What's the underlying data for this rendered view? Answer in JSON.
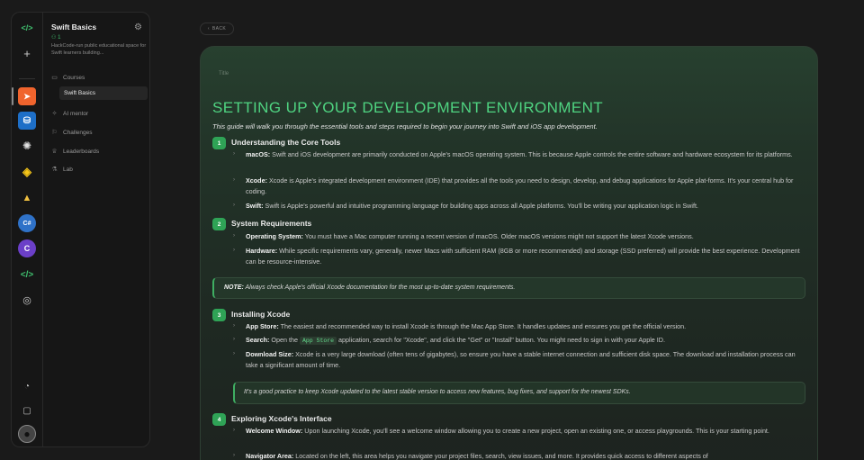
{
  "sidebar": {
    "title": "Swift Basics",
    "members": "1",
    "description": "HackCode-run public educational space for Swift learners building...",
    "nav": [
      {
        "icon": "book-icon",
        "glyph": "▭",
        "label": "Courses"
      },
      {
        "icon": "sparkle-icon",
        "glyph": "✧",
        "label": "AI mentor"
      },
      {
        "icon": "flag-icon",
        "glyph": "⚐",
        "label": "Challenges"
      },
      {
        "icon": "trophy-icon",
        "glyph": "♕",
        "label": "Leaderboards"
      },
      {
        "icon": "flask-icon",
        "glyph": "⚗",
        "label": "Lab"
      }
    ],
    "active_course": "Swift Basics"
  },
  "rail": {
    "top": [
      {
        "icon": "code-logo-icon",
        "glyph": "</>"
      },
      {
        "icon": "add-icon",
        "glyph": "+"
      }
    ],
    "spaces": [
      {
        "icon": "swift-icon",
        "glyph": "➤"
      },
      {
        "icon": "database-icon",
        "glyph": "⛁"
      },
      {
        "icon": "openai-icon",
        "glyph": "✺"
      },
      {
        "icon": "python-icon",
        "glyph": "◈"
      },
      {
        "icon": "linux-icon",
        "glyph": "▲"
      },
      {
        "icon": "csharp-icon",
        "glyph": "C#"
      },
      {
        "icon": "c-icon",
        "glyph": "C"
      },
      {
        "icon": "code-icon",
        "glyph": "</>"
      },
      {
        "icon": "compass-icon",
        "glyph": "◎"
      }
    ],
    "bottom": [
      {
        "icon": "bell-icon",
        "glyph": "◔"
      },
      {
        "icon": "chat-icon",
        "glyph": "▢"
      },
      {
        "icon": "avatar-icon",
        "glyph": "●"
      }
    ]
  },
  "back_label": "BACK",
  "content": {
    "breadcrumb": [
      "Title",
      ""
    ],
    "title": "SETTING UP YOUR DEVELOPMENT ENVIRONMENT",
    "intro": "This guide will walk you through the essential tools and steps required to begin your journey into Swift and iOS app development.",
    "sections": [
      {
        "num": "1",
        "title": "Understanding the Core Tools",
        "items": [
          {
            "term": "macOS:",
            "text": " Swift and iOS development are primarily conducted on Apple's macOS operating system. This is because Apple controls the entire software and hardware ecosystem for its platforms."
          },
          {
            "term": "Xcode:",
            "text": " Xcode is Apple's integrated development environment (IDE) that provides all the tools you need to design, develop, and debug applications for Apple plat-forms. It's your central hub for coding."
          },
          {
            "term": "Swift:",
            "text": " Swift is Apple's powerful and intuitive programming language for building apps across all Apple platforms. You'll be writing your application logic in Swift."
          }
        ]
      },
      {
        "num": "2",
        "title": "System Requirements",
        "items": [
          {
            "term": "Operating System:",
            "text": " You must have a Mac computer running a recent version of macOS. Older macOS versions might not support the latest Xcode versions."
          },
          {
            "term": "Hardware:",
            "text": " While specific requirements vary, generally, newer Macs with sufficient RAM (8GB or more recommended) and storage (SSD preferred) will provide the best experience. Development can be resource-intensive."
          }
        ]
      },
      {
        "num": "3",
        "title": "Installing Xcode",
        "items": [
          {
            "term": "App Store:",
            "text": " The easiest and recommended way to install Xcode is through the Mac App Store. It handles updates and ensures you get the official version."
          },
          {
            "term": "Search:",
            "text_before": " Open the ",
            "code": "App Store",
            "text_after": " application, search for \"Xcode\", and click the \"Get\" or \"Install\" button. You might need to sign in with your Apple ID."
          },
          {
            "term": "Download Size:",
            "text": " Xcode is a very large download (often tens of gigabytes), so ensure you have a stable internet connection and sufficient disk space. The download and installation process can take a significant amount of time."
          }
        ]
      },
      {
        "num": "4",
        "title": "Exploring Xcode's Interface",
        "items": [
          {
            "term": "Welcome Window:",
            "text": " Upon launching Xcode, you'll see a welcome window allowing you to create a new project, open an existing one, or access playgrounds. This is your starting point."
          },
          {
            "term": "Navigator Area:",
            "text": " Located on the left, this area helps you navigate your project files, search, view issues, and more. It provides quick access to different aspects of"
          }
        ]
      }
    ],
    "note_label": "NOTE:",
    "note_text": " Always check Apple's official Xcode documentation for the most up-to-date system requirements.",
    "tip_text": "It's a good practice to keep Xcode updated to the latest stable version to access new features, bug fixes, and support for the newest SDKs."
  },
  "colors": {
    "accent": "#4fd481",
    "badge": "#2fa356",
    "swift": "#f0642d"
  }
}
